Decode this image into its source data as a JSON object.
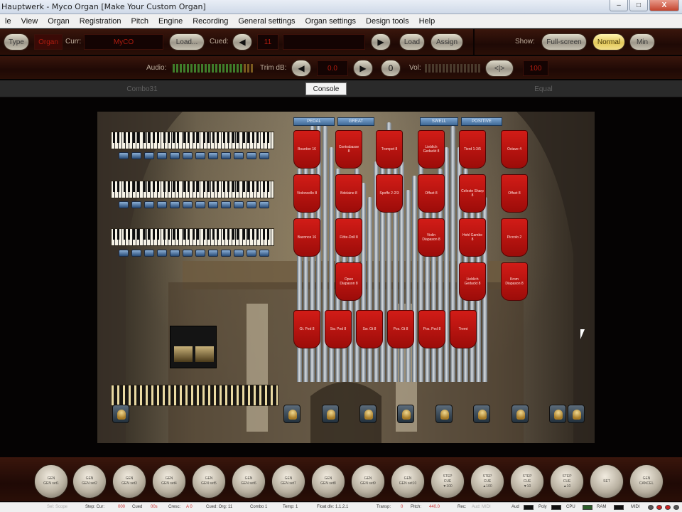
{
  "window": {
    "title": "Hauptwerk - Myco Organ  [Make Your Custom Organ]",
    "buttons": [
      "–",
      "□",
      "X"
    ]
  },
  "menu": [
    "le",
    "View",
    "Organ",
    "Registration",
    "Pitch",
    "Engine",
    "Recording",
    "General settings",
    "Organ settings",
    "Design tools",
    "Help"
  ],
  "toolbar1": {
    "type_label": "Type",
    "type_value": "Organ",
    "curr_label": "Curr:",
    "curr_value": "MyCO",
    "load_label": "Load...",
    "cued_label": "Cued:",
    "cued_value": "11",
    "prev_icon": "◀",
    "next_icon": "▶",
    "load2_label": "Load",
    "assign_label": "Assign",
    "show_label": "Show:",
    "fullscreen_label": "Full-screen",
    "normal_label": "Normal",
    "min_label": "Min"
  },
  "toolbar2": {
    "audio_label": "Audio:",
    "trim_label": "Trim dB:",
    "trim_value": "0.0",
    "zero_label": "0",
    "vol_label": "Vol:",
    "vol_value": "100",
    "lr_label": "<|>",
    "prev_icon": "◀",
    "next_icon": "▶"
  },
  "tabs": [
    "Combo31",
    "Console",
    "Equal"
  ],
  "divisions": [
    "PEDAL",
    "GREAT",
    "SWELL",
    "POSITIVE"
  ],
  "stops": [
    "Bourdon 16",
    "Contrabasse 8",
    "Trompet 8",
    "Lieblich Gedackt 8",
    "Tierd 1-3/5",
    "Octave 4",
    "Violoncello 8",
    "Bdelaine 8",
    "Spoffe 2-2/3",
    "Offset 8",
    "Celeste Sharp 8",
    "Offset 8",
    "Bazonce 16",
    "Flöte-Doll 8",
    "Violin Diapason 8",
    "Hohl Gambe 8",
    "Piccolo 2",
    "Open Diapason 8",
    "Lieblich Gedackt 8",
    "Krom Diapason 8",
    "Gt. Ped 8",
    "Sw. Ped 8",
    "Sw. Gt 8",
    "Pos. Gt 8",
    "Pos. Ped 8",
    "Tremt"
  ],
  "general_pistons": [
    "GEN\nGEN set1",
    "GEN\nGEN set2",
    "GEN\nGEN set3",
    "GEN\nGEN set4",
    "GEN\nGEN set5",
    "GEN\nGEN set6",
    "GEN\nGEN set7",
    "GEN\nGEN set8",
    "GEN\nGEN set9",
    "GEN\nGEN set10",
    "STEP\nCUE\n▼100",
    "STEP\nCUE\n▲100",
    "STEP\nCUE\n▼10",
    "STEP\nCUE\n▲10",
    "SET",
    "GEN\nCANCEL"
  ],
  "status": {
    "sel_label": "Sel: Scope",
    "step_label": "Step: Cur:",
    "step_cur": "000",
    "cued_label": "Cued",
    "cued_value": "00s",
    "cresc_label": "Cresc:",
    "cresc_value": "A 0",
    "cued_org": "Cued: Org: 11",
    "combo": "Combo 1",
    "temp": "Temp: 1",
    "float": "Float div: 1.1.2.1",
    "transp_label": "Transp:",
    "transp_value": "0",
    "pitch_label": "Pitch:",
    "pitch_value": "440.0",
    "rec_label": "Rec:",
    "rec_value": "Aud: MIDI",
    "aud": "Aud",
    "poly": "Poly",
    "cpu": "CPU",
    "ram": "RAM",
    "midi": "MIDI"
  }
}
